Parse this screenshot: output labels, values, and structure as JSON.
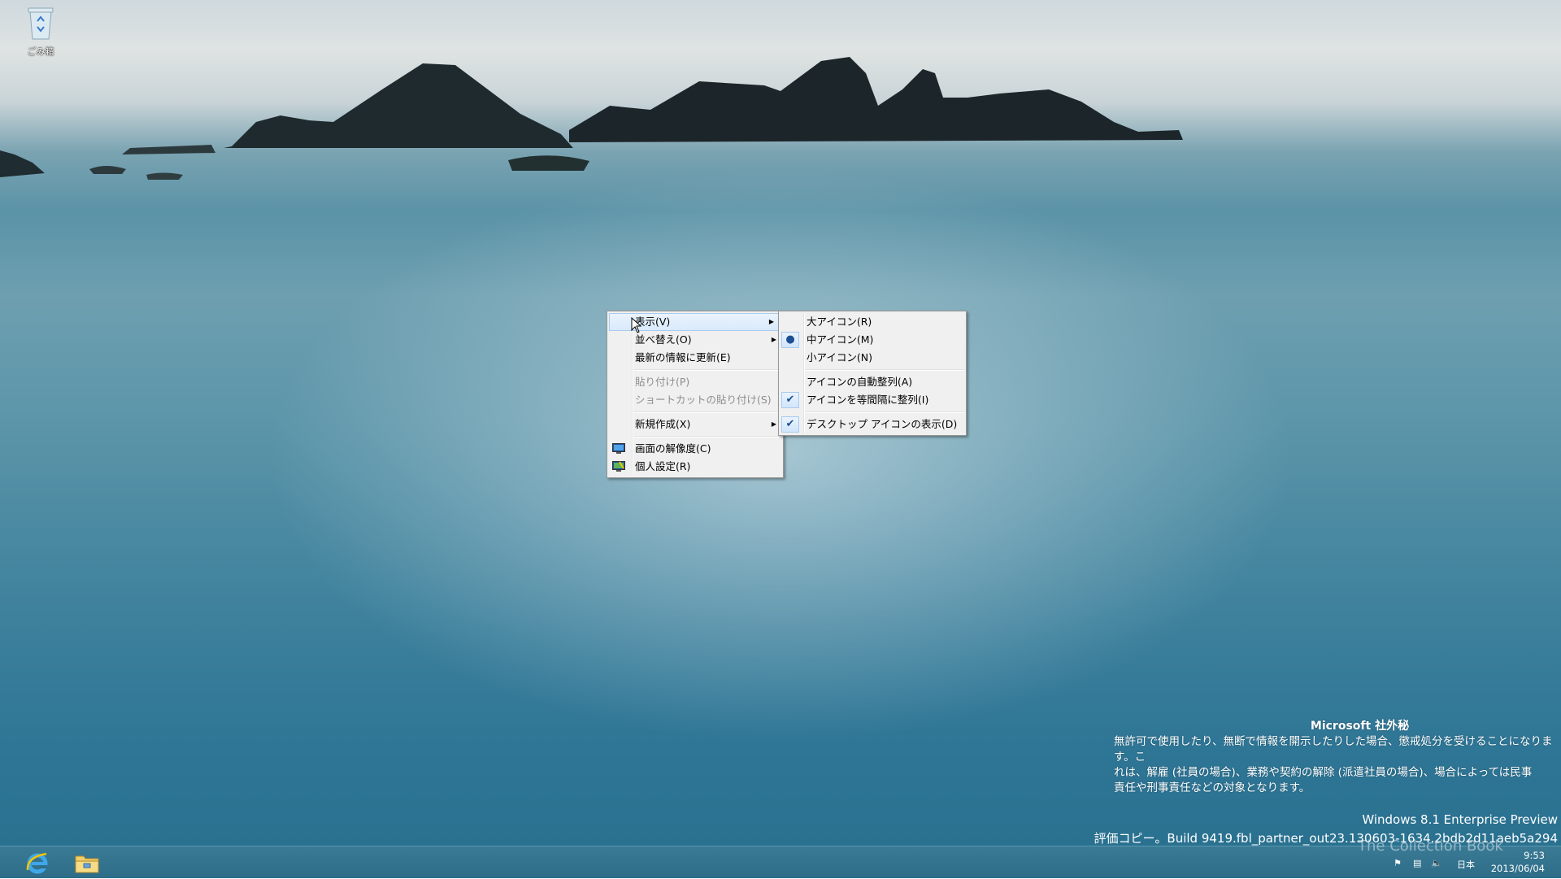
{
  "desktop": {
    "recycle_bin_label": "ごみ箱"
  },
  "context_menu": {
    "items": [
      {
        "label": "表示(V)",
        "submenu": true,
        "active": true
      },
      {
        "label": "並べ替え(O)",
        "submenu": true
      },
      {
        "label": "最新の情報に更新(E)"
      },
      {
        "label": "貼り付け(P)",
        "disabled": true
      },
      {
        "label": "ショートカットの貼り付け(S)",
        "disabled": true
      },
      {
        "label": "新規作成(X)",
        "submenu": true
      },
      {
        "label": "画面の解像度(C)",
        "icon": "display-icon"
      },
      {
        "label": "個人設定(R)",
        "icon": "personalize-icon"
      }
    ]
  },
  "view_submenu": {
    "items": [
      {
        "label": "大アイコン(R)"
      },
      {
        "label": "中アイコン(M)",
        "mark": "radio"
      },
      {
        "label": "小アイコン(N)"
      },
      {
        "label": "アイコンの自動整列(A)"
      },
      {
        "label": "アイコンを等間隔に整列(I)",
        "mark": "check"
      },
      {
        "label": "デスクトップ アイコンの表示(D)",
        "mark": "check"
      }
    ]
  },
  "watermark": {
    "heading": "Microsoft 社外秘",
    "line1": "無許可で使用したり、無断で情報を開示したりした場合、懲戒処分を受けることになります。こ",
    "line2": "れは、解雇 (社員の場合)、業務や契約の解除 (派遣社員の場合)、場合によっては民事",
    "line3": "責任や刑事責任などの対象となります。",
    "edition": "Windows 8.1 Enterprise Preview",
    "build": "評価コピー。Build 9419.fbl_partner_out23.130603-1634.2bdb2d11aeb5a294"
  },
  "taskbar": {
    "tray_ime": "日本",
    "time": "9:53",
    "date": "2013/06/04",
    "overlay_text": "The Collection Book"
  },
  "colors": {
    "taskbar": "#2e6d88",
    "menu_bg": "#f0f0f0",
    "menu_highlight": "#d9eafc"
  }
}
